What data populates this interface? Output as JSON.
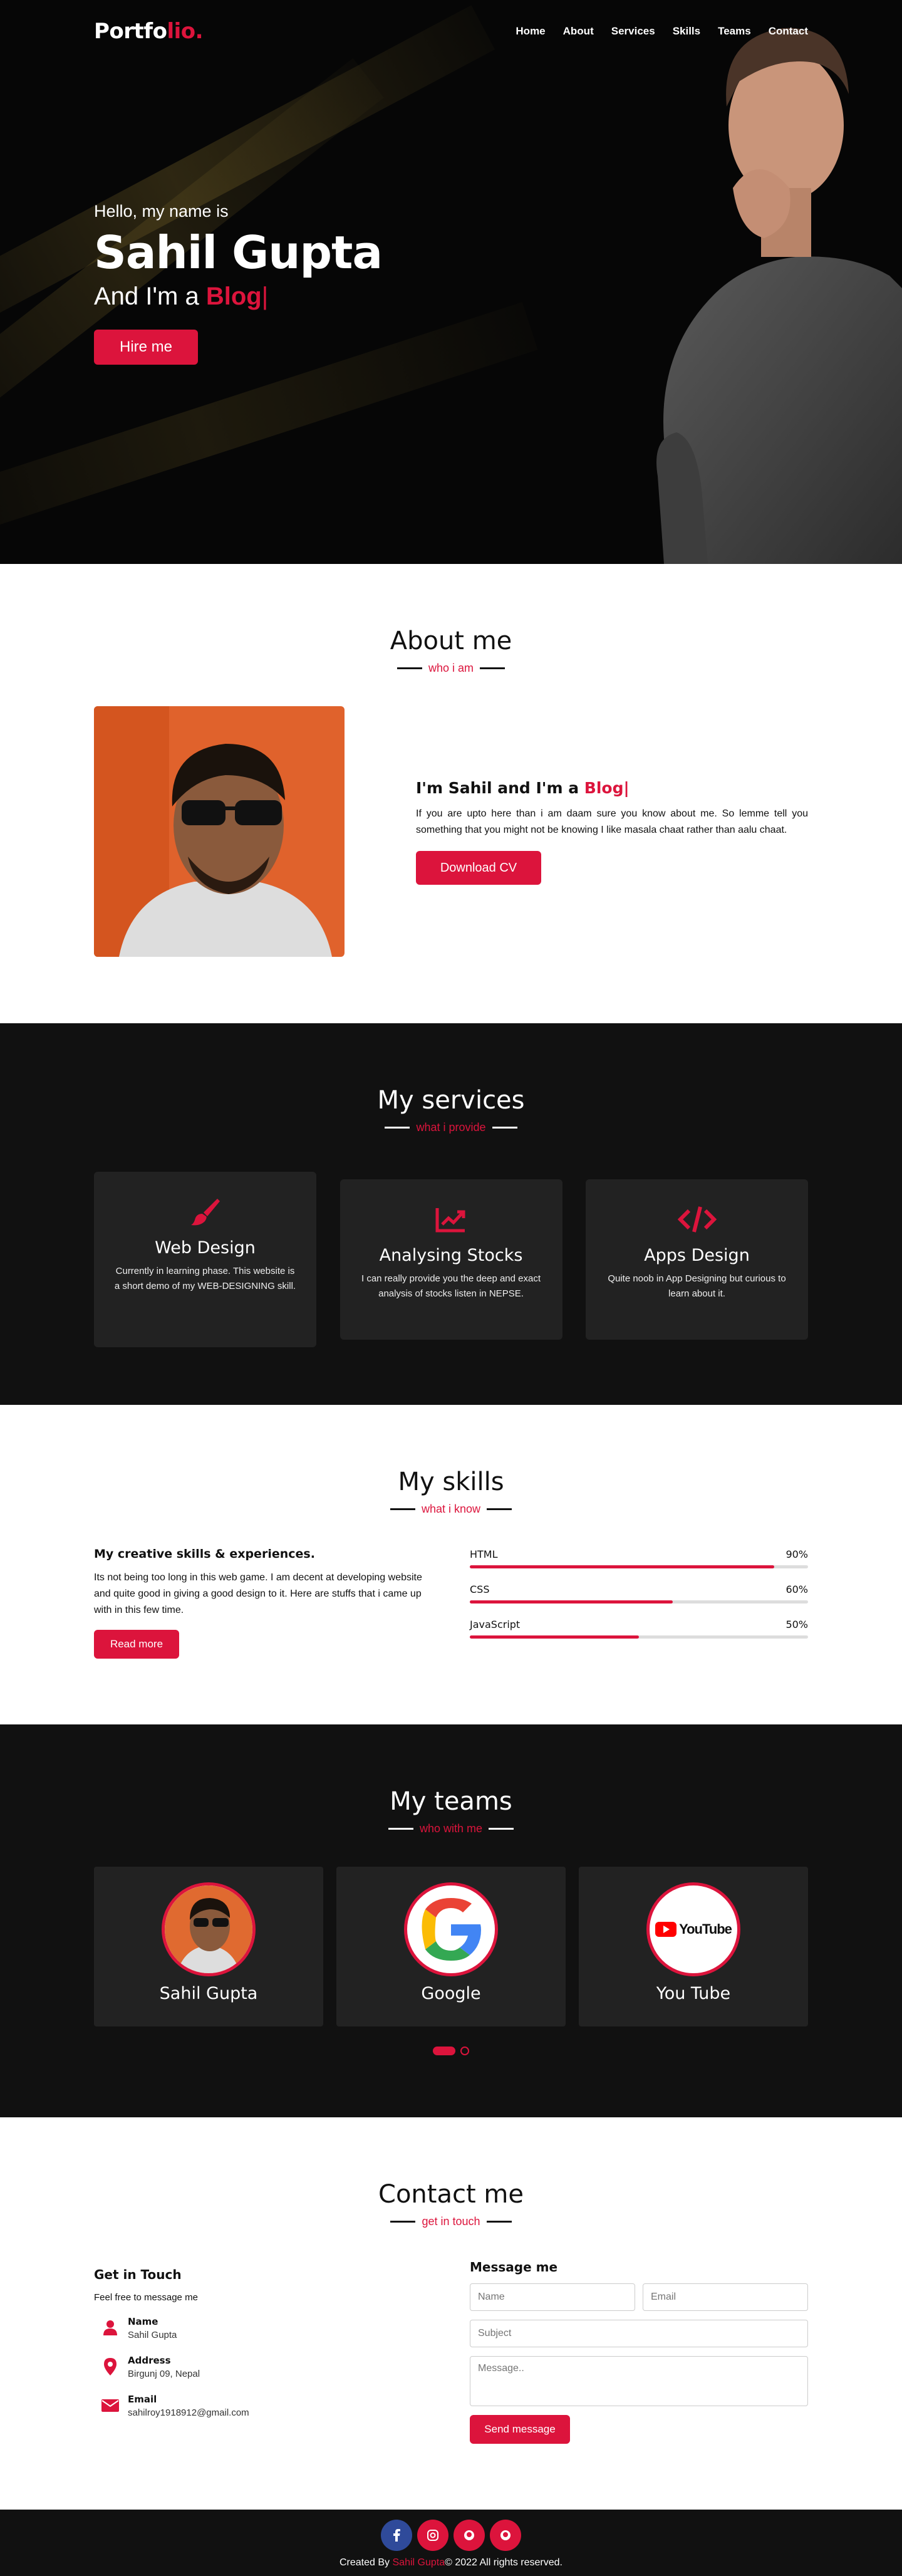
{
  "nav": {
    "logo_main": "Portfo",
    "logo_accent": "lio.",
    "links": [
      "Home",
      "About",
      "Services",
      "Skills",
      "Teams",
      "Contact"
    ]
  },
  "hero": {
    "greeting": "Hello, my name is",
    "name": "Sahil Gupta",
    "role_prefix": "And I'm a",
    "role_typed": "Blog",
    "caret": "|",
    "button": "Hire me"
  },
  "about": {
    "title": "About me",
    "subtitle": "who i am",
    "heading_prefix": "I'm Sahil and I'm a",
    "heading_typed": "Blog|",
    "paragraph": "If you are upto here than i am daam sure you know about me. So lemme tell you something that you might not be knowing I like masala chaat rather than aalu chaat.",
    "button": "Download CV"
  },
  "services": {
    "title": "My services",
    "subtitle": "what i provide",
    "cards": [
      {
        "icon": "paint-brush-icon",
        "title": "Web Design",
        "text": "Currently in learning phase. This website is a short demo of my WEB-DESIGNING skill."
      },
      {
        "icon": "chart-line-icon",
        "title": "Analysing Stocks",
        "text": "I can really provide you the deep and exact analysis of stocks listen in NEPSE."
      },
      {
        "icon": "code-icon",
        "title": "Apps Design",
        "text": "Quite noob in App Designing but curious to learn about it."
      }
    ]
  },
  "skills": {
    "title": "My skills",
    "subtitle": "what i know",
    "heading": "My creative skills & experiences.",
    "paragraph": "Its not being too long in this web game. I am decent at developing website and quite good in giving a good design to it. Here are stuffs that i came up with in this few time.",
    "button": "Read more",
    "bars": [
      {
        "name": "HTML",
        "percent": "90%",
        "value": 0.9
      },
      {
        "name": "CSS",
        "percent": "60%",
        "value": 0.6
      },
      {
        "name": "JavaScript",
        "percent": "50%",
        "value": 0.5
      }
    ]
  },
  "teams": {
    "title": "My teams",
    "subtitle": "who with me",
    "members": [
      {
        "name": "Sahil Gupta",
        "image": "person-avatar"
      },
      {
        "name": "Google",
        "image": "google-logo"
      },
      {
        "name": "You Tube",
        "image": "youtube-logo",
        "logo_text": "YouTube"
      }
    ]
  },
  "contact": {
    "title": "Contact me",
    "subtitle": "get in touch",
    "left_heading": "Get in Touch",
    "lead": "Feel free to message me",
    "items": [
      {
        "icon": "user-icon",
        "label": "Name",
        "value": "Sahil Gupta"
      },
      {
        "icon": "map-marker-icon",
        "label": "Address",
        "value": "Birgunj 09, Nepal"
      },
      {
        "icon": "envelope-icon",
        "label": "Email",
        "value": "sahilroy1918912@gmail.com"
      }
    ],
    "form_heading": "Message me",
    "placeholders": {
      "name": "Name",
      "email": "Email",
      "subject": "Subject",
      "message": "Message.."
    },
    "button": "Send message"
  },
  "footer": {
    "socials": [
      "facebook-icon",
      "instagram-icon",
      "github-icon",
      "github-icon"
    ],
    "copy_prefix": "Created By",
    "copy_name": "Sahil Gupta",
    "copy_suffix": "© 2022 All rights reserved."
  },
  "colors": {
    "accent": "#dc143c",
    "dark": "#111111",
    "card": "#222222"
  }
}
